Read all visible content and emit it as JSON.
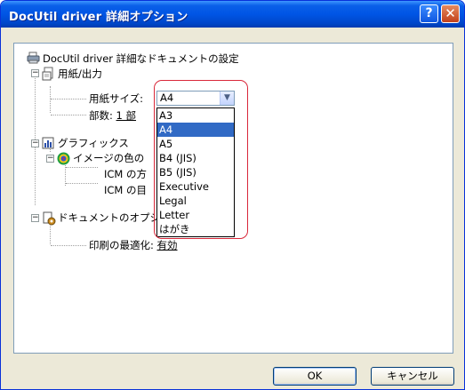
{
  "window": {
    "title": "DocUtil driver 詳細オプション",
    "help_button": "?",
    "close_button": "✕"
  },
  "tree": {
    "root_label": "DocUtil driver 詳細なドキュメントの設定",
    "paper_output": "用紙/出力",
    "paper_size_label": "用紙サイズ:",
    "copies_label": "部数:",
    "copies_value": "1 部",
    "graphics": "グラフィックス",
    "image_color": "イメージの色の",
    "icm_method": "ICM の方",
    "icm_intent": "ICM の目",
    "document_options": "ドキュメントのオプシ",
    "print_optimize_label": "印刷の最適化:",
    "print_optimize_value": "有効"
  },
  "paper_size": {
    "selected": "A4",
    "options": [
      "A3",
      "A4",
      "A5",
      "B4 (JIS)",
      "B5 (JIS)",
      "Executive",
      "Legal",
      "Letter",
      "はがき"
    ]
  },
  "buttons": {
    "ok": "OK",
    "cancel": "キャンセル"
  },
  "colors": {
    "titlebar": "#0055e5",
    "selection": "#316ac5",
    "highlight": "#d9283a"
  }
}
